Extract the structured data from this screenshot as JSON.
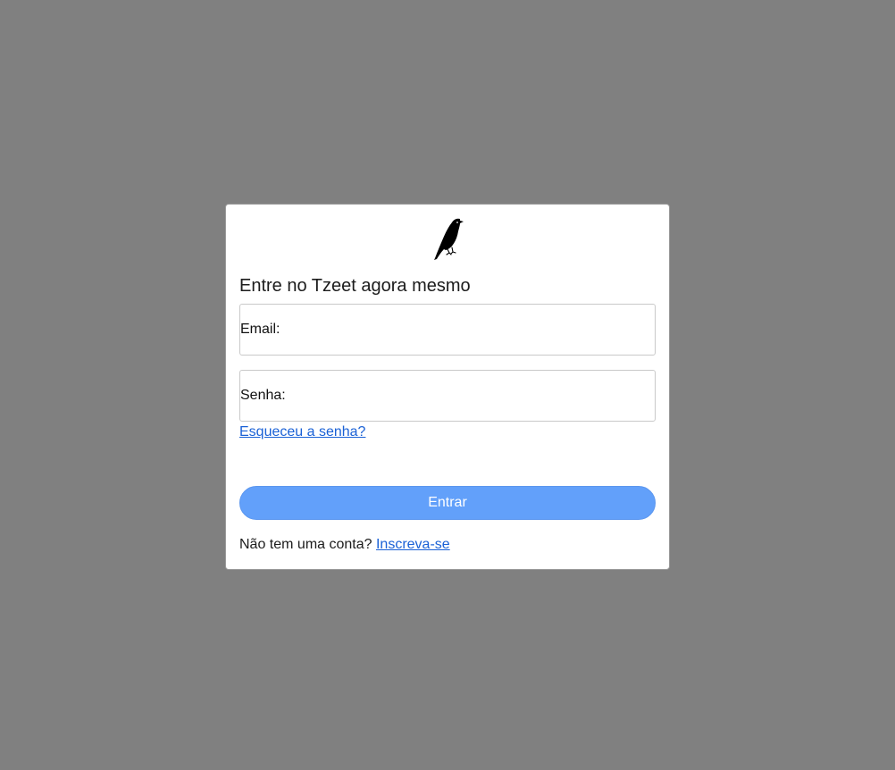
{
  "login": {
    "logo_icon": "bird-icon",
    "title": "Entre no Tzeet agora mesmo",
    "email_label": "Email:",
    "email_value": "",
    "password_label": "Senha:",
    "password_value": "",
    "forgot_link": "Esqueceu a senha?",
    "submit_label": "Entrar",
    "signup_prompt": "Não tem uma conta?",
    "signup_link": "Inscreva-se"
  },
  "colors": {
    "backdrop": "#808080",
    "card": "#ffffff",
    "button": "#62a0fa",
    "link": "#1a61d6"
  }
}
